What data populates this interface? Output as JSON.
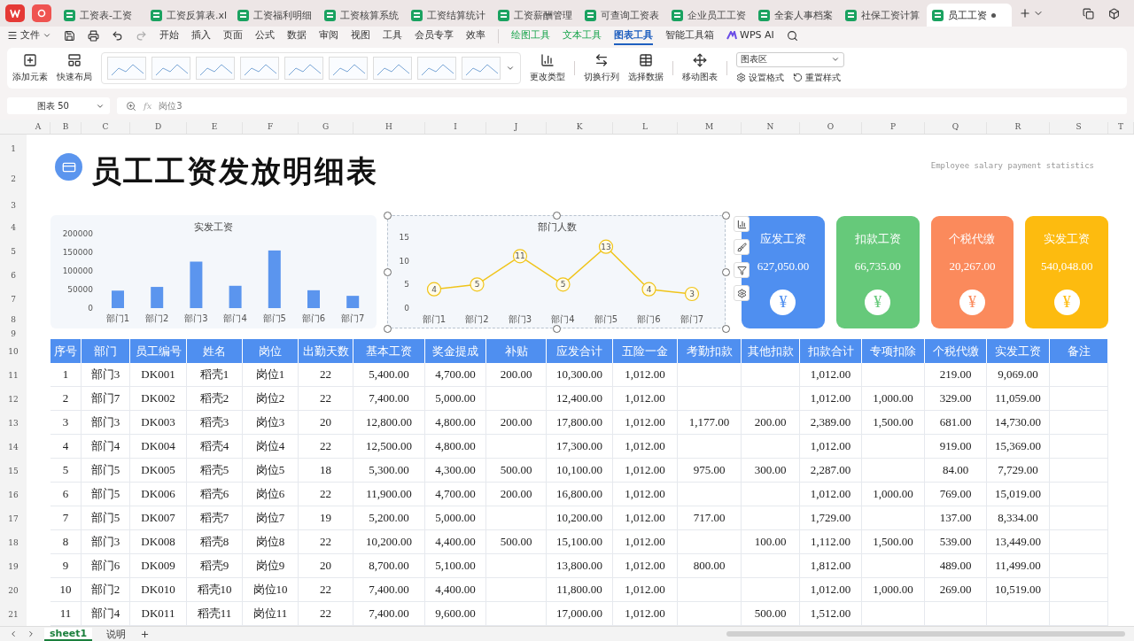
{
  "title_bar": {
    "tabs": [
      {
        "label": "工资表-工资",
        "selected": false
      },
      {
        "label": "工资反算表.xl",
        "selected": false
      },
      {
        "label": "工资福利明细",
        "selected": false
      },
      {
        "label": "工资核算系统",
        "selected": false
      },
      {
        "label": "工资结算统计",
        "selected": false
      },
      {
        "label": "工资薪酬管理",
        "selected": false
      },
      {
        "label": "可查询工资表",
        "selected": false
      },
      {
        "label": "企业员工工资",
        "selected": false
      },
      {
        "label": "全套人事档案",
        "selected": false
      },
      {
        "label": "社保工资计算",
        "selected": false
      },
      {
        "label": "员工工资",
        "selected": true
      }
    ]
  },
  "menu": {
    "file": "文件",
    "items": [
      {
        "label": "开始",
        "kind": "main",
        "selected": false
      },
      {
        "label": "插入",
        "kind": "main",
        "selected": false
      },
      {
        "label": "页面",
        "kind": "main",
        "selected": false
      },
      {
        "label": "公式",
        "kind": "main",
        "selected": false
      },
      {
        "label": "数据",
        "kind": "main",
        "selected": false
      },
      {
        "label": "审阅",
        "kind": "main",
        "selected": false
      },
      {
        "label": "视图",
        "kind": "main",
        "selected": false
      },
      {
        "label": "工具",
        "kind": "main",
        "selected": false
      },
      {
        "label": "会员专享",
        "kind": "main",
        "selected": false
      },
      {
        "label": "效率",
        "kind": "main",
        "selected": false
      },
      {
        "label": "绘图工具",
        "kind": "context",
        "selected": false
      },
      {
        "label": "文本工具",
        "kind": "context",
        "selected": false
      },
      {
        "label": "图表工具",
        "kind": "context",
        "selected": true
      },
      {
        "label": "智能工具箱",
        "kind": "main",
        "selected": false
      },
      {
        "label": "WPS AI",
        "kind": "ai",
        "selected": false
      }
    ]
  },
  "ribbon": {
    "add_element": "添加元素",
    "quick_layout": "快速布局",
    "change_type": "更改类型",
    "switch_row_col": "切换行列",
    "select_data": "选择数据",
    "move_chart": "移动图表",
    "element_select": "图表区",
    "set_format": "设置格式",
    "reset_style": "重置样式"
  },
  "formula_bar": {
    "name_box": "图表 50",
    "fx_label": "fx",
    "formula": "岗位3"
  },
  "column_headers": [
    "A",
    "B",
    "C",
    "D",
    "E",
    "F",
    "G",
    "H",
    "I",
    "J",
    "K",
    "L",
    "M",
    "N",
    "O",
    "P",
    "Q",
    "R",
    "S",
    "T"
  ],
  "row_numbers": [
    "1",
    "2",
    "3",
    "4",
    "5",
    "6",
    "7",
    "8",
    "9",
    "10",
    "11",
    "12",
    "13",
    "14",
    "15",
    "16",
    "17",
    "18",
    "19",
    "20",
    "21"
  ],
  "sheet": {
    "title": "员工工资发放明细表",
    "subtitle": "Employee salary payment statistics",
    "charts": [
      {
        "chart_data": {
          "type": "bar",
          "title": "实发工资",
          "categories": [
            "部门1",
            "部门2",
            "部门3",
            "部门4",
            "部门5",
            "部门6",
            "部门7"
          ],
          "series": [
            {
              "color": "#5b95ee",
              "values": [
                47000,
                57000,
                125000,
                60000,
                155000,
                48000,
                33000
              ]
            }
          ],
          "ylim": [
            0,
            200000
          ],
          "yticks": [
            0,
            50000,
            100000,
            150000,
            200000
          ]
        }
      },
      {
        "chart_data": {
          "type": "line",
          "title": "部门人数",
          "categories": [
            "部门1",
            "部门2",
            "部门3",
            "部门4",
            "部门5",
            "部门6",
            "部门7"
          ],
          "series": [
            {
              "color": "#f0c419",
              "marker": true,
              "values": [
                4,
                5,
                11,
                5,
                13,
                4,
                3
              ]
            }
          ],
          "ylim": [
            0,
            15
          ],
          "yticks": [
            0,
            5,
            10,
            15
          ],
          "data_labels": true
        }
      }
    ],
    "cards": [
      {
        "label": "应发工资",
        "value": "627,050.00",
        "symbol": "¥",
        "color": "#4f8ff0"
      },
      {
        "label": "扣款工资",
        "value": "66,735.00",
        "symbol": "¥",
        "color": "#66c97a"
      },
      {
        "label": "个税代缴",
        "value": "20,267.00",
        "symbol": "¥",
        "color": "#fb8a5c"
      },
      {
        "label": "实发工资",
        "value": "540,048.00",
        "symbol": "¥",
        "color": "#fdbb0f"
      }
    ],
    "table": {
      "columns": [
        "序号",
        "部门",
        "员工编号",
        "姓名",
        "岗位",
        "出勤天数",
        "基本工资",
        "奖金提成",
        "补贴",
        "应发合计",
        "五险一金",
        "考勤扣款",
        "其他扣款",
        "扣款合计",
        "专项扣除",
        "个税代缴",
        "实发工资",
        "备注"
      ],
      "rows": [
        [
          "1",
          "部门3",
          "DK001",
          "稻壳1",
          "岗位1",
          "22",
          "5,400.00",
          "4,700.00",
          "200.00",
          "10,300.00",
          "1,012.00",
          null,
          null,
          "1,012.00",
          null,
          "219.00",
          "9,069.00",
          null
        ],
        [
          "2",
          "部门7",
          "DK002",
          "稻壳2",
          "岗位2",
          "22",
          "7,400.00",
          "5,000.00",
          null,
          "12,400.00",
          "1,012.00",
          null,
          null,
          "1,012.00",
          "1,000.00",
          "329.00",
          "11,059.00",
          null
        ],
        [
          "3",
          "部门3",
          "DK003",
          "稻壳3",
          "岗位3",
          "20",
          "12,800.00",
          "4,800.00",
          "200.00",
          "17,800.00",
          "1,012.00",
          "1,177.00",
          "200.00",
          "2,389.00",
          "1,500.00",
          "681.00",
          "14,730.00",
          null
        ],
        [
          "4",
          "部门4",
          "DK004",
          "稻壳4",
          "岗位4",
          "22",
          "12,500.00",
          "4,800.00",
          null,
          "17,300.00",
          "1,012.00",
          null,
          null,
          "1,012.00",
          null,
          "919.00",
          "15,369.00",
          null
        ],
        [
          "5",
          "部门5",
          "DK005",
          "稻壳5",
          "岗位5",
          "18",
          "5,300.00",
          "4,300.00",
          "500.00",
          "10,100.00",
          "1,012.00",
          "975.00",
          "300.00",
          "2,287.00",
          null,
          "84.00",
          "7,729.00",
          null
        ],
        [
          "6",
          "部门5",
          "DK006",
          "稻壳6",
          "岗位6",
          "22",
          "11,900.00",
          "4,700.00",
          "200.00",
          "16,800.00",
          "1,012.00",
          null,
          null,
          "1,012.00",
          "1,000.00",
          "769.00",
          "15,019.00",
          null
        ],
        [
          "7",
          "部门5",
          "DK007",
          "稻壳7",
          "岗位7",
          "19",
          "5,200.00",
          "5,000.00",
          null,
          "10,200.00",
          "1,012.00",
          "717.00",
          null,
          "1,729.00",
          null,
          "137.00",
          "8,334.00",
          null
        ],
        [
          "8",
          "部门3",
          "DK008",
          "稻壳8",
          "岗位8",
          "22",
          "10,200.00",
          "4,400.00",
          "500.00",
          "15,100.00",
          "1,012.00",
          null,
          "100.00",
          "1,112.00",
          "1,500.00",
          "539.00",
          "13,449.00",
          null
        ],
        [
          "9",
          "部门6",
          "DK009",
          "稻壳9",
          "岗位9",
          "20",
          "8,700.00",
          "5,100.00",
          null,
          "13,800.00",
          "1,012.00",
          "800.00",
          null,
          "1,812.00",
          null,
          "489.00",
          "11,499.00",
          null
        ],
        [
          "10",
          "部门2",
          "DK010",
          "稻壳10",
          "岗位10",
          "22",
          "7,400.00",
          "4,400.00",
          null,
          "11,800.00",
          "1,012.00",
          null,
          null,
          "1,012.00",
          "1,000.00",
          "269.00",
          "10,519.00",
          null
        ],
        [
          "11",
          "部门4",
          "DK011",
          "稻壳11",
          "岗位11",
          "22",
          "7,400.00",
          "9,600.00",
          null,
          "17,000.00",
          "1,012.00",
          null,
          "500.00",
          "1,512.00",
          null,
          null,
          null,
          null
        ]
      ]
    }
  },
  "sheet_tabs": [
    {
      "label": "sheet1",
      "selected": true
    },
    {
      "label": "说明",
      "selected": false
    }
  ]
}
